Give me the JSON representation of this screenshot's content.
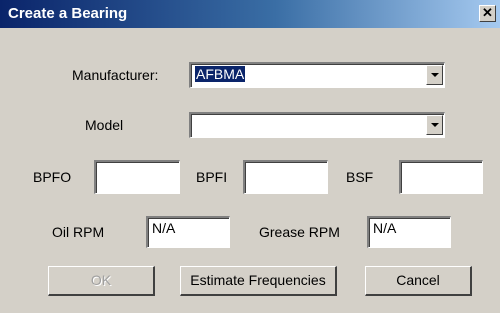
{
  "window": {
    "title": "Create a Bearing",
    "close_glyph": "✕"
  },
  "manufacturer": {
    "label": "Manufacturer:",
    "value": "AFBMA"
  },
  "model": {
    "label": "Model",
    "value": ""
  },
  "frequencies": {
    "bpfo": {
      "label": "BPFO",
      "value": ""
    },
    "bpfi": {
      "label": "BPFI",
      "value": ""
    },
    "bsf": {
      "label": "BSF",
      "value": ""
    }
  },
  "rpm": {
    "oil": {
      "label": "Oil RPM",
      "value": "N/A"
    },
    "grease": {
      "label": "Grease RPM",
      "value": "N/A"
    }
  },
  "buttons": {
    "ok": "OK",
    "estimate": "Estimate Frequencies",
    "cancel": "Cancel"
  },
  "icons": {
    "dropdown": "chevron-down-icon",
    "close": "close-icon"
  },
  "colors": {
    "titlebar_start": "#0a246a",
    "titlebar_end": "#a6caf0",
    "dialog_face": "#d4d0c8",
    "selection": "#0a246a"
  }
}
